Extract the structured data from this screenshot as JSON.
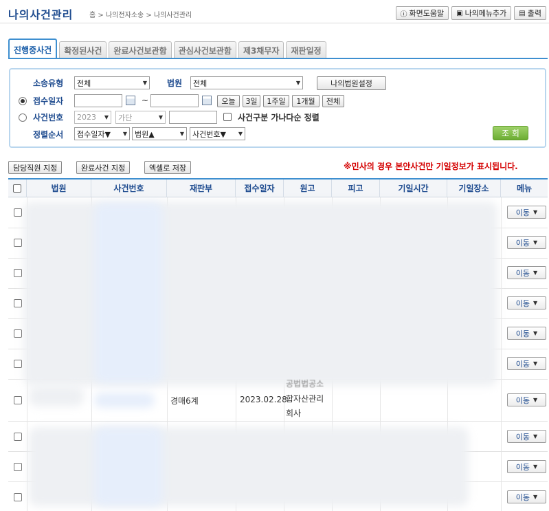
{
  "header": {
    "title": "나의사건관리",
    "breadcrumb": [
      "홈",
      "나의전자소송",
      "나의사건관리"
    ],
    "breadcrumb_sep": ">",
    "buttons": {
      "help": "화면도움말",
      "add_menu": "나의메뉴추가",
      "print": "출력"
    }
  },
  "tabs": [
    {
      "label": "진행중사건",
      "active": true
    },
    {
      "label": "확정된사건"
    },
    {
      "label": "완료사건보관함"
    },
    {
      "label": "관심사건보관함"
    },
    {
      "label": "제3채무자"
    },
    {
      "label": "재판일정"
    }
  ],
  "search": {
    "case_type_label": "소송유형",
    "case_type_value": "전체",
    "court_label": "법원",
    "court_value": "전체",
    "my_court_btn": "나의법원설정",
    "date_label": "접수일자",
    "date_sep": "~",
    "date_buttons": [
      "오늘",
      "3일",
      "1주일",
      "1개월",
      "전체"
    ],
    "case_no_label": "사건번호",
    "year_value": "2023",
    "type_value": "가단",
    "sort_check_label": "사건구분 가나다순 정렬",
    "sort_label": "정렬순서",
    "sort1": "접수일자▼",
    "sort2": "법원▲",
    "sort3": "사건번호▼",
    "search_btn": "조 회"
  },
  "actions": {
    "assign": "담당직원 지정",
    "complete": "완료사건 지정",
    "excel": "엑셀로 저장"
  },
  "notice": "※민사의 경우 본안사건만 기일정보가 표시됩니다.",
  "table": {
    "columns": [
      "법원",
      "사건번호",
      "재판부",
      "접수일자",
      "원고",
      "피고",
      "기일시간",
      "기일장소",
      "메뉴"
    ],
    "visible_row": {
      "division": "경매6계",
      "date": "2023.02.28",
      "plaintiff": "합자산관리회사",
      "plaintiff_top": "공법법공소"
    },
    "move_label": "이동"
  }
}
